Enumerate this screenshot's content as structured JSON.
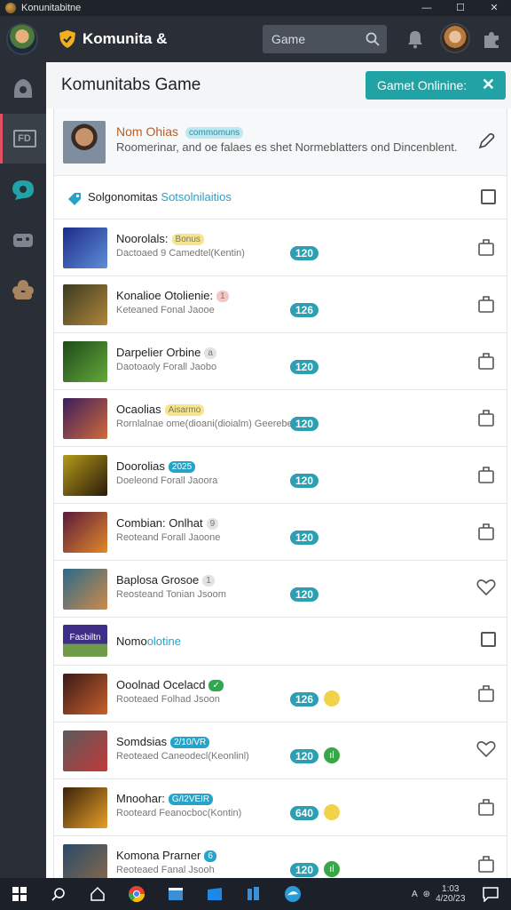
{
  "window": {
    "title": "Konunitabitne",
    "controls": [
      "—",
      "☐",
      "✕"
    ]
  },
  "topbar": {
    "brand": "Komunita &",
    "search_placeholder": "Game"
  },
  "sidebar": {
    "items": [
      "home-icon",
      "fd-icon",
      "chat-icon",
      "controller-icon",
      "friends-icon"
    ],
    "fd_label": "FD"
  },
  "panel": {
    "title": "Komunitabs Game",
    "online_button": "Gamet Onlinine:"
  },
  "profile": {
    "name": "Nom Ohias",
    "tag": "commomuns",
    "text": "Roomerinar, and oe falaes es shet Normeblatters ond Dincenblent."
  },
  "category": {
    "label1": "Solgonomitas",
    "label2": "Sotsolnilaitios"
  },
  "games": [
    {
      "name": "Noorolals:",
      "tag": "Bonus",
      "tag_color": "#f6e58a",
      "sub": "Dactoaed 9 Camedtel(Kentin)",
      "count": "120",
      "thumb": [
        "#1d2b8a",
        "#5d8fd6"
      ],
      "action": "cup"
    },
    {
      "name": "Konalioe Otolienie:",
      "tag": "1",
      "tag_color": "#f5c6c6",
      "sub": "Keteaned Fonal Jaooe",
      "count": "126",
      "thumb": [
        "#3a3a22",
        "#b0863a"
      ],
      "action": "cup"
    },
    {
      "name": "Darpelier Orbine",
      "tag": "a",
      "tag_color": "#e3e3e3",
      "sub": "Daotoaoly Forall Jaobo",
      "count": "120",
      "thumb": [
        "#1d4a1a",
        "#64a83a"
      ],
      "action": "cup"
    },
    {
      "name": "Ocaolias",
      "tag": "Aisarmo",
      "tag_color": "#f6e58a",
      "sub": "Rornlalnae ome(dioani(dioialm) Geerebeton.",
      "count": "120",
      "thumb": [
        "#3a1e5c",
        "#d26a3a"
      ],
      "action": "cup"
    },
    {
      "name": "Doorolias",
      "tag": "2025",
      "tag_color": "#27a3c9",
      "sub": "Doeleond Forall Jaoora",
      "count": "120",
      "thumb": [
        "#b39a1a",
        "#2a1a0a"
      ],
      "action": "cup"
    },
    {
      "name": "Combian: Onlhat",
      "tag": "9",
      "tag_color": "#e3e3e3",
      "sub": "Reoteand Forall Jaoone",
      "count": "120",
      "thumb": [
        "#5c1a3a",
        "#e08a2a"
      ],
      "action": "cup"
    },
    {
      "name": "Baplosa Grosoe",
      "tag": "1",
      "tag_color": "#e3e3e3",
      "sub": "Reosteand Tonian Jsoom",
      "count": "120",
      "thumb": [
        "#2a6a8a",
        "#cf8a4a"
      ],
      "action": "heart"
    }
  ],
  "special": {
    "thumb_text": "Fasbiltn",
    "name1": "Nomo",
    "name2": "olotine"
  },
  "games2": [
    {
      "name": "Ooolnad Ocelacd",
      "tag": "✓",
      "tag_color": "#2fa84f",
      "sub": "Rooteaed Folhad Jsoon",
      "count": "126",
      "dot": "",
      "dot_color": "#f0d34a",
      "thumb": [
        "#3a1a1a",
        "#c8602a"
      ],
      "action": "cup"
    },
    {
      "name": "Somdsias",
      "tag": "2/10/VR",
      "tag_color": "#27a3c9",
      "sub": "Reoteaed Caneodecl(Keonlinl)",
      "count": "120",
      "dot": "ıl",
      "dot_color": "#37a845",
      "thumb": [
        "#5a5a5a",
        "#c23a3a"
      ],
      "action": "heart"
    },
    {
      "name": "Mnoohar:",
      "tag": "G/I2VEIR",
      "tag_color": "#27a3c9",
      "sub": "Rooteard Feanocboc(Kontin)",
      "count": "640",
      "dot": "",
      "dot_color": "#f0d34a",
      "thumb": [
        "#3a220a",
        "#e8a02a"
      ],
      "action": "cup"
    },
    {
      "name": "Komona Prarner",
      "tag": "6",
      "tag_color": "#27a3c9",
      "sub": "Reoteaed Fanal Jsooh",
      "count": "120",
      "dot": "ıl",
      "dot_color": "#37a845",
      "thumb": [
        "#2a4a6a",
        "#8a6a4a"
      ],
      "action": "cup"
    }
  ],
  "taskbar": {
    "time": "1:03",
    "date": "4/20/23",
    "tray_badge": "A"
  }
}
